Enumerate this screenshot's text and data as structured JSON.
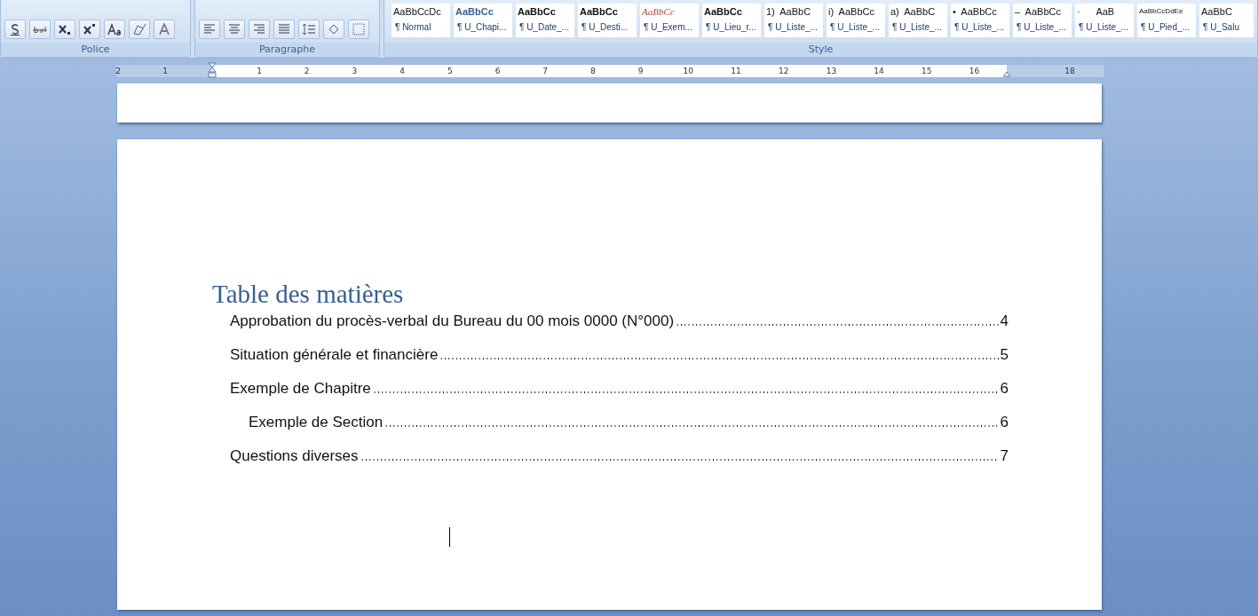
{
  "ribbon": {
    "groups": [
      {
        "label": "Police",
        "kind": "font"
      },
      {
        "label": "Paragraphe",
        "kind": "paragraph"
      },
      {
        "label": "Style",
        "kind": "styles"
      }
    ],
    "styles": [
      {
        "sample": "AaBbCcDc",
        "name": "¶ Normal",
        "kind": "plain",
        "selected": false
      },
      {
        "sample": "AaBbCc",
        "name": "¶ U_Chapi...",
        "kind": "heading",
        "selected": false
      },
      {
        "sample": "AaBbCc",
        "name": "¶ U_Date_...",
        "kind": "bold",
        "selected": false
      },
      {
        "sample": "AaBbCc",
        "name": "¶ U_Desti...",
        "kind": "bold",
        "selected": false
      },
      {
        "sample": "AaBbCc",
        "name": "¶ U_Exem...",
        "kind": "italic",
        "selected": false
      },
      {
        "sample": "AaBbCc",
        "name": "¶ U_Lieu_r...",
        "kind": "bold",
        "selected": false
      },
      {
        "sample": "1)  AaBbC",
        "name": "¶ U_Liste_...",
        "kind": "plain",
        "selected": false
      },
      {
        "sample": "i)  AaBbCc",
        "name": "¶ U_Liste_...",
        "kind": "plain",
        "selected": false
      },
      {
        "sample": "a)  AaBbC",
        "name": "¶ U_Liste_...",
        "kind": "plain",
        "selected": false
      },
      {
        "sample": "•  AaBbCc",
        "name": "¶ U_Liste_...",
        "kind": "plain",
        "selected": false
      },
      {
        "sample": "–  AaBbCc",
        "name": "¶ U_Liste_...",
        "kind": "plain",
        "selected": false
      },
      {
        "sample": "·      AaB",
        "name": "¶ U_Liste_...",
        "kind": "plain",
        "selected": false
      },
      {
        "sample": "AaBbCcDdEe",
        "name": "¶ U_Pied_...",
        "kind": "small",
        "selected": false
      },
      {
        "sample": "AaBbC",
        "name": "¶ U_Salu",
        "kind": "plain",
        "selected": false
      }
    ]
  },
  "ruler": {
    "labels": [
      "2",
      "1",
      "1",
      "2",
      "3",
      "4",
      "5",
      "6",
      "7",
      "8",
      "9",
      "10",
      "11",
      "12",
      "13",
      "14",
      "15",
      "16",
      "18"
    ]
  },
  "document": {
    "title": "Table des matières",
    "toc": [
      {
        "text": "Approbation du procès-verbal du Bureau du 00 mois 0000 (N°000)",
        "page": "4"
      },
      {
        "text": "Situation générale et financière",
        "page": "5"
      },
      {
        "text": "Exemple de Chapitre",
        "page": "6",
        "children": [
          {
            "text": "Exemple de Section",
            "page": "6"
          }
        ]
      },
      {
        "text": "Questions diverses",
        "page": "7"
      }
    ]
  }
}
